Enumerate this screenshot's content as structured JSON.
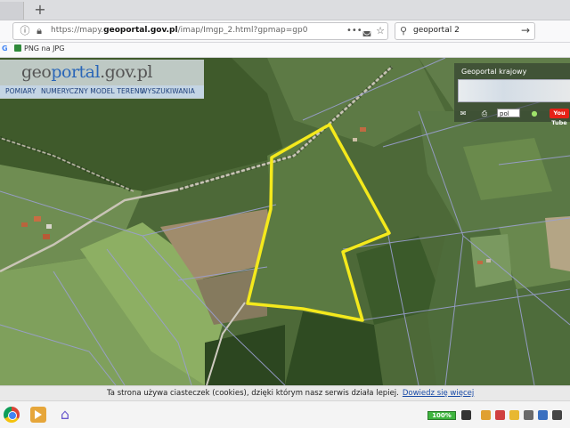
{
  "browser": {
    "new_tab_symbol": "+",
    "url_prefix": "https://mapy.",
    "url_domain": "geoportal.gov.pl",
    "url_suffix": "/imap/Imgp_2.html?gpmap=gp0",
    "search_value": "geoportal 2",
    "bookmarks": [
      {
        "label": "G",
        "icon": "google-icon"
      },
      {
        "label": "PNG na JPG",
        "icon": "bookmark-page-icon"
      }
    ]
  },
  "app": {
    "logo_prefix": "geo",
    "logo_accent": "portal",
    "logo_suffix": ".gov.pl",
    "menu": [
      "POMIARY",
      "NUMERYCZNY MODEL TERENU",
      "WYSZUKIWANIA"
    ],
    "overview_title": "Geoportal krajowy",
    "language": "pol",
    "youtube_label": "You Tube"
  },
  "cookie": {
    "text": "Ta strona używa ciasteczek (cookies), dzięki którym nasz serwis działa lepiej.",
    "link": "Dowiedz się więcej"
  },
  "taskbar": {
    "battery_label": "100%"
  },
  "colors": {
    "parcel_outline": "#f4e91c",
    "cadastral_lines": "#9a9fd0",
    "accent_blue": "#2a66b8"
  }
}
